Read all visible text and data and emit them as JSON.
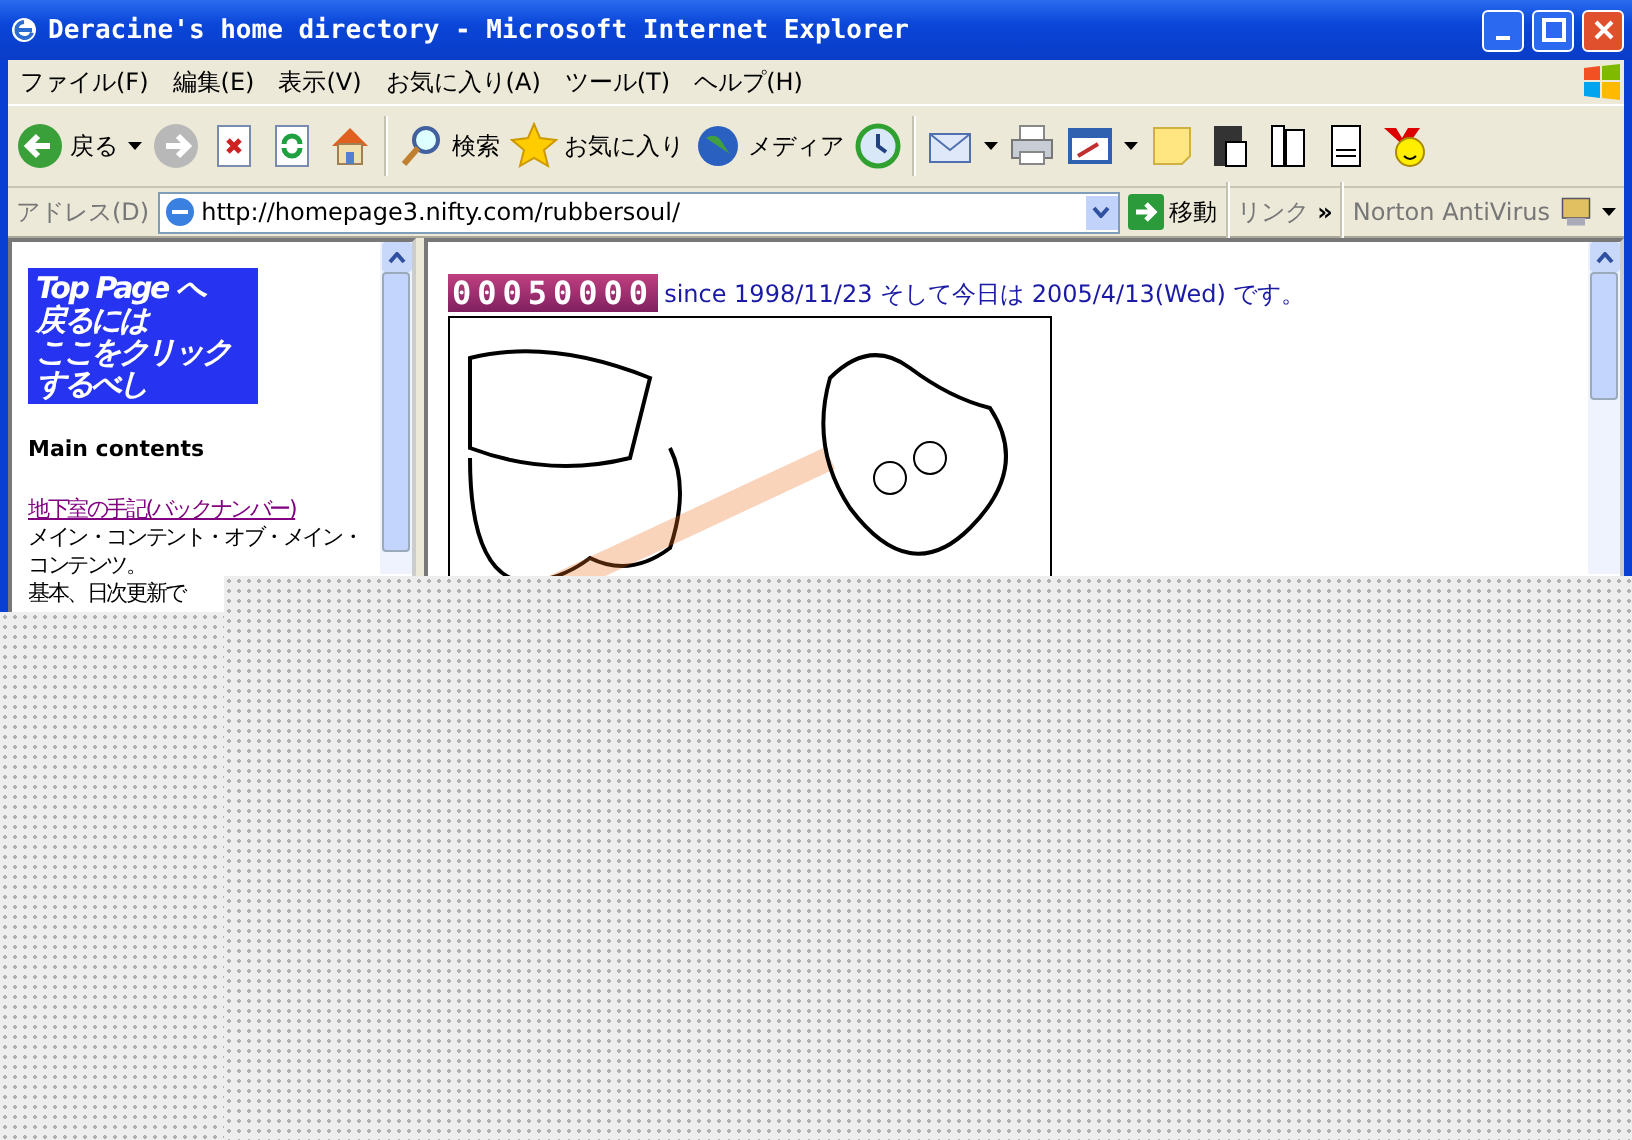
{
  "window": {
    "title": "Deracine's home directory - Microsoft Internet Explorer"
  },
  "menu": [
    "ファイル(F)",
    "編集(E)",
    "表示(V)",
    "お気に入り(A)",
    "ツール(T)",
    "ヘルプ(H)"
  ],
  "toolbar": {
    "back": "戻る",
    "search": "検索",
    "favorites": "お気に入り",
    "media": "メディア"
  },
  "address": {
    "label": "アドレス(D)",
    "url": "http://homepage3.nifty.com/rubbersoul/",
    "go": "移動",
    "links": "リンク",
    "chevron": "»",
    "norton": "Norton AntiVirus"
  },
  "left_frame": {
    "banner": [
      "Top Page へ",
      "戻るには",
      "ここをクリック",
      "するべし"
    ],
    "heading": "Main contents",
    "link": "地下室の手記(バックナンバー)",
    "description": "メイン・コンテント・オブ・メイン・コンテンツ。",
    "note": "基本、日次更新で"
  },
  "right_frame": {
    "counter": "00050000",
    "since": "since 1998/11/23 そして今日は 2005/4/13(Wed) です。"
  }
}
